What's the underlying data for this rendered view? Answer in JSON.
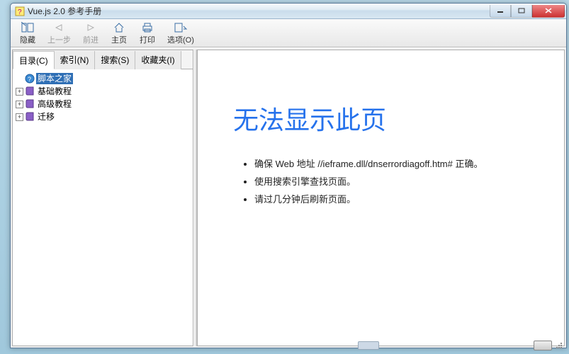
{
  "window": {
    "title": "Vue.js 2.0 参考手册"
  },
  "toolbar": {
    "hide": "隐藏",
    "back": "上一步",
    "forward": "前进",
    "home": "主页",
    "print": "打印",
    "options": "选项(O)"
  },
  "tabs": {
    "contents": "目录(C)",
    "index": "索引(N)",
    "search": "搜索(S)",
    "favorites": "收藏夹(I)"
  },
  "tree": {
    "items": [
      {
        "label": "脚本之家",
        "selected": true,
        "expandable": false
      },
      {
        "label": "基础教程",
        "selected": false,
        "expandable": true
      },
      {
        "label": "高级教程",
        "selected": false,
        "expandable": true
      },
      {
        "label": "迁移",
        "selected": false,
        "expandable": true
      }
    ]
  },
  "error": {
    "heading": "无法显示此页",
    "bullets": [
      "确保 Web 地址 //ieframe.dll/dnserrordiagoff.htm# 正确。",
      "使用搜索引擎查找页面。",
      "请过几分钟后刷新页面。"
    ]
  }
}
